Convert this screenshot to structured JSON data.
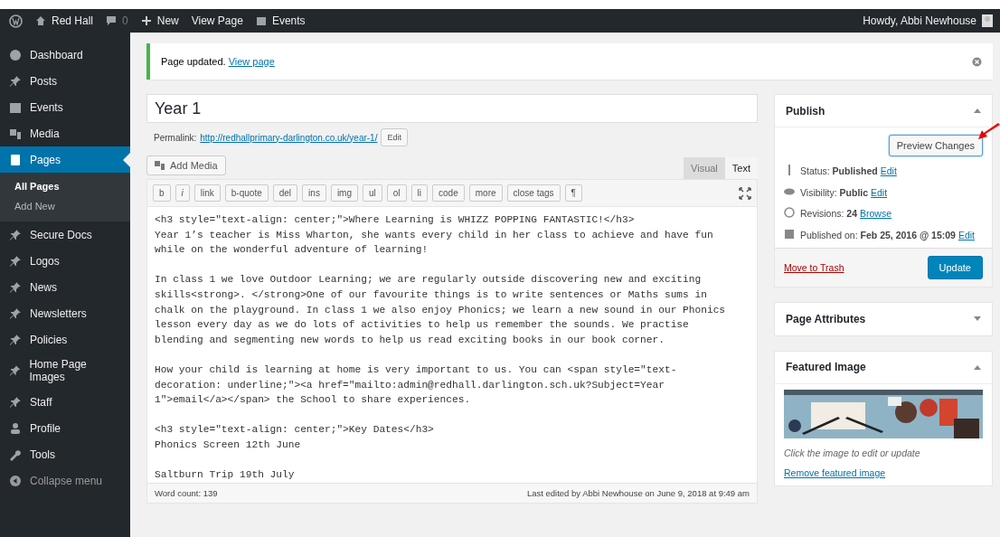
{
  "admin_bar": {
    "site": "Red Hall",
    "comments": "0",
    "new": "New",
    "view": "View Page",
    "events": "Events",
    "greeting": "Howdy, Abbi Newhouse"
  },
  "sidebar": {
    "items": [
      {
        "label": "Dashboard",
        "selected": false
      },
      {
        "label": "Posts",
        "selected": false
      },
      {
        "label": "Events",
        "selected": false
      },
      {
        "label": "Media",
        "selected": false
      },
      {
        "label": "Pages",
        "selected": true,
        "children": [
          {
            "label": "All Pages",
            "selected": true
          },
          {
            "label": "Add New",
            "selected": false
          }
        ]
      },
      {
        "label": "Secure Docs",
        "selected": false
      },
      {
        "label": "Logos",
        "selected": false
      },
      {
        "label": "News",
        "selected": false
      },
      {
        "label": "Newsletters",
        "selected": false
      },
      {
        "label": "Policies",
        "selected": false
      },
      {
        "label": "Home Page Images",
        "selected": false
      },
      {
        "label": "Staff",
        "selected": false
      },
      {
        "label": "Profile",
        "selected": false
      },
      {
        "label": "Tools",
        "selected": false
      }
    ],
    "collapse": "Collapse menu"
  },
  "notice": {
    "text": "Page updated.",
    "link": "View page"
  },
  "title": "Year 1",
  "permalink": {
    "label": "Permalink:",
    "url": "http://redhallprimary-darlington.co.uk/year-1/",
    "button": "Edit"
  },
  "add_media": "Add Media",
  "editor_tabs": [
    {
      "label": "Visual",
      "selected": false
    },
    {
      "label": "Text",
      "selected": true
    }
  ],
  "quicktags": [
    "b",
    "i",
    "link",
    "b-quote",
    "del",
    "ins",
    "img",
    "ul",
    "ol",
    "li",
    "code",
    "more",
    "close tags",
    "¶"
  ],
  "content_paragraphs": [
    [
      "<h3 style=\"text-align: center;\">Where Learning is WHIZZ POPPING FANTASTIC!</h3>",
      "Year 1’s teacher is Miss Wharton, she wants every child in her class to achieve and have fun",
      "while on the wonderful adventure of learning!"
    ],
    [
      "In class 1 we love Outdoor Learning; we are regularly outside discovering new and exciting",
      "skills<strong>. </strong>One of our favourite things is to write sentences or Maths sums in",
      "chalk on the playground. In class 1 we also enjoy Phonics; we learn a new sound in our Phonics",
      "lesson every day as we do lots of activities to help us remember the sounds. We practise",
      "blending and segmenting new words to help us read exciting books in our book corner."
    ],
    [
      "How your child is learning at home is very important to us. You can <span style=\"text-",
      "decoration: underline;\"><a href=\"mailto:admin@redhall.darlington.sch.uk?Subject=Year",
      "1\">email</a></span> the School to share experiences."
    ],
    [
      "<h3 style=\"text-align: center;\">Key Dates</h3>",
      "Phonics Screen 12th June"
    ],
    [
      "Saltburn Trip 19th July"
    ]
  ],
  "word_count": "Word count: 139",
  "last_edited": "Last edited by Abbi Newhouse on June 9, 2018 at 9:49 am",
  "publish": {
    "title": "Publish",
    "expanded": true,
    "preview": "Preview Changes",
    "rows": [
      {
        "text": "Status: **Published**",
        "link": "Edit"
      },
      {
        "text": "Visibility: **Public**",
        "link": "Edit"
      },
      {
        "text": "Revisions: **24**",
        "link": "Browse"
      },
      {
        "text": "Published on: **Feb 25, 2016 @ 15:09**",
        "link": "Edit"
      }
    ],
    "trash": "Move to Trash",
    "update": "Update"
  },
  "page_attributes": {
    "title": "Page Attributes",
    "expanded": false
  },
  "featured_image": {
    "title": "Featured Image",
    "expanded": true,
    "hint": "Click the image to edit or update",
    "remove": "Remove featured image"
  }
}
